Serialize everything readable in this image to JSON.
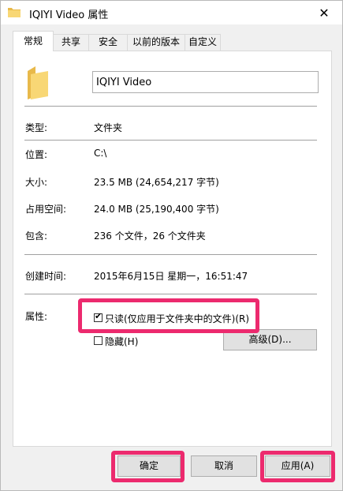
{
  "window": {
    "title": "IQIYI Video 属性",
    "close_glyph": "✕"
  },
  "tabs": [
    {
      "label": "常规"
    },
    {
      "label": "共享"
    },
    {
      "label": "安全"
    },
    {
      "label": "以前的版本"
    },
    {
      "label": "自定义"
    }
  ],
  "general": {
    "name_value": "IQIYI Video",
    "type": {
      "label": "类型:",
      "value": "文件夹"
    },
    "location": {
      "label": "位置:",
      "value": "C:\\"
    },
    "size": {
      "label": "大小:",
      "value": "23.5 MB (24,654,217 字节)"
    },
    "size_on_disk": {
      "label": "占用空间:",
      "value": "24.0 MB (25,190,400 字节)"
    },
    "contains": {
      "label": "包含:",
      "value": "236 个文件，26 个文件夹"
    },
    "created": {
      "label": "创建时间:",
      "value": "2015年6月15日 星期一，16:51:47"
    },
    "attributes": {
      "label": "属性:",
      "readonly_label": "只读(仅应用于文件夹中的文件)(R)",
      "readonly_checked": true,
      "hidden_label": "隐藏(H)",
      "hidden_checked": false,
      "advanced_label": "高级(D)..."
    }
  },
  "footer": {
    "ok_label": "确定",
    "cancel_label": "取消",
    "apply_label": "应用(A)"
  },
  "colors": {
    "highlight": "#ec2a6e",
    "folder": "#f8d775"
  },
  "icons": {
    "title": "folder-icon",
    "big": "folder-icon",
    "close": "close-icon"
  }
}
